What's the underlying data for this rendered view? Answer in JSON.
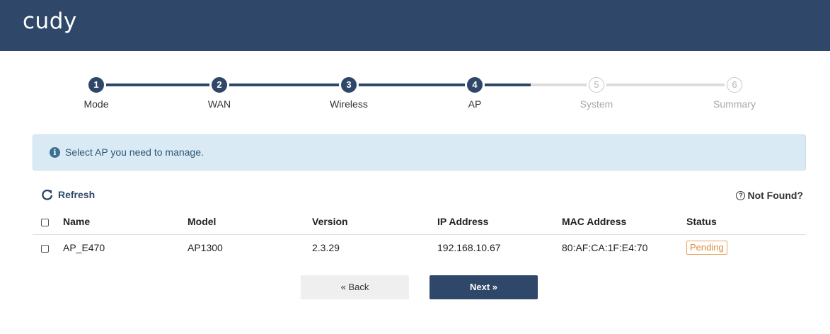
{
  "header": {
    "logo_text": "cudy",
    "bg_color": "#2f4769"
  },
  "wizard": {
    "steps": [
      {
        "number": "1",
        "label": "Mode",
        "state": "done"
      },
      {
        "number": "2",
        "label": "WAN",
        "state": "done"
      },
      {
        "number": "3",
        "label": "Wireless",
        "state": "done"
      },
      {
        "number": "4",
        "label": "AP",
        "state": "current"
      },
      {
        "number": "5",
        "label": "System",
        "state": "todo"
      },
      {
        "number": "6",
        "label": "Summary",
        "state": "todo"
      }
    ]
  },
  "alert": {
    "icon": "info-icon",
    "message": "Select AP you need to manage."
  },
  "toolbar": {
    "refresh_label": "Refresh",
    "refresh_icon": "refresh-icon",
    "not_found_label": "Not Found?",
    "not_found_icon": "question-circle-icon"
  },
  "table": {
    "columns": [
      "Name",
      "Model",
      "Version",
      "IP Address",
      "MAC Address",
      "Status"
    ],
    "rows": [
      {
        "name": "AP_E470",
        "model": "AP1300",
        "version": "2.3.29",
        "ip": "192.168.10.67",
        "mac": "80:AF:CA:1F:E4:70",
        "status": "Pending"
      }
    ]
  },
  "buttons": {
    "back_label": "« Back",
    "next_label": "Next »"
  },
  "colors": {
    "accent": "#2f4769",
    "pending": "#e08a33",
    "alert_bg": "#d9eaf4"
  }
}
